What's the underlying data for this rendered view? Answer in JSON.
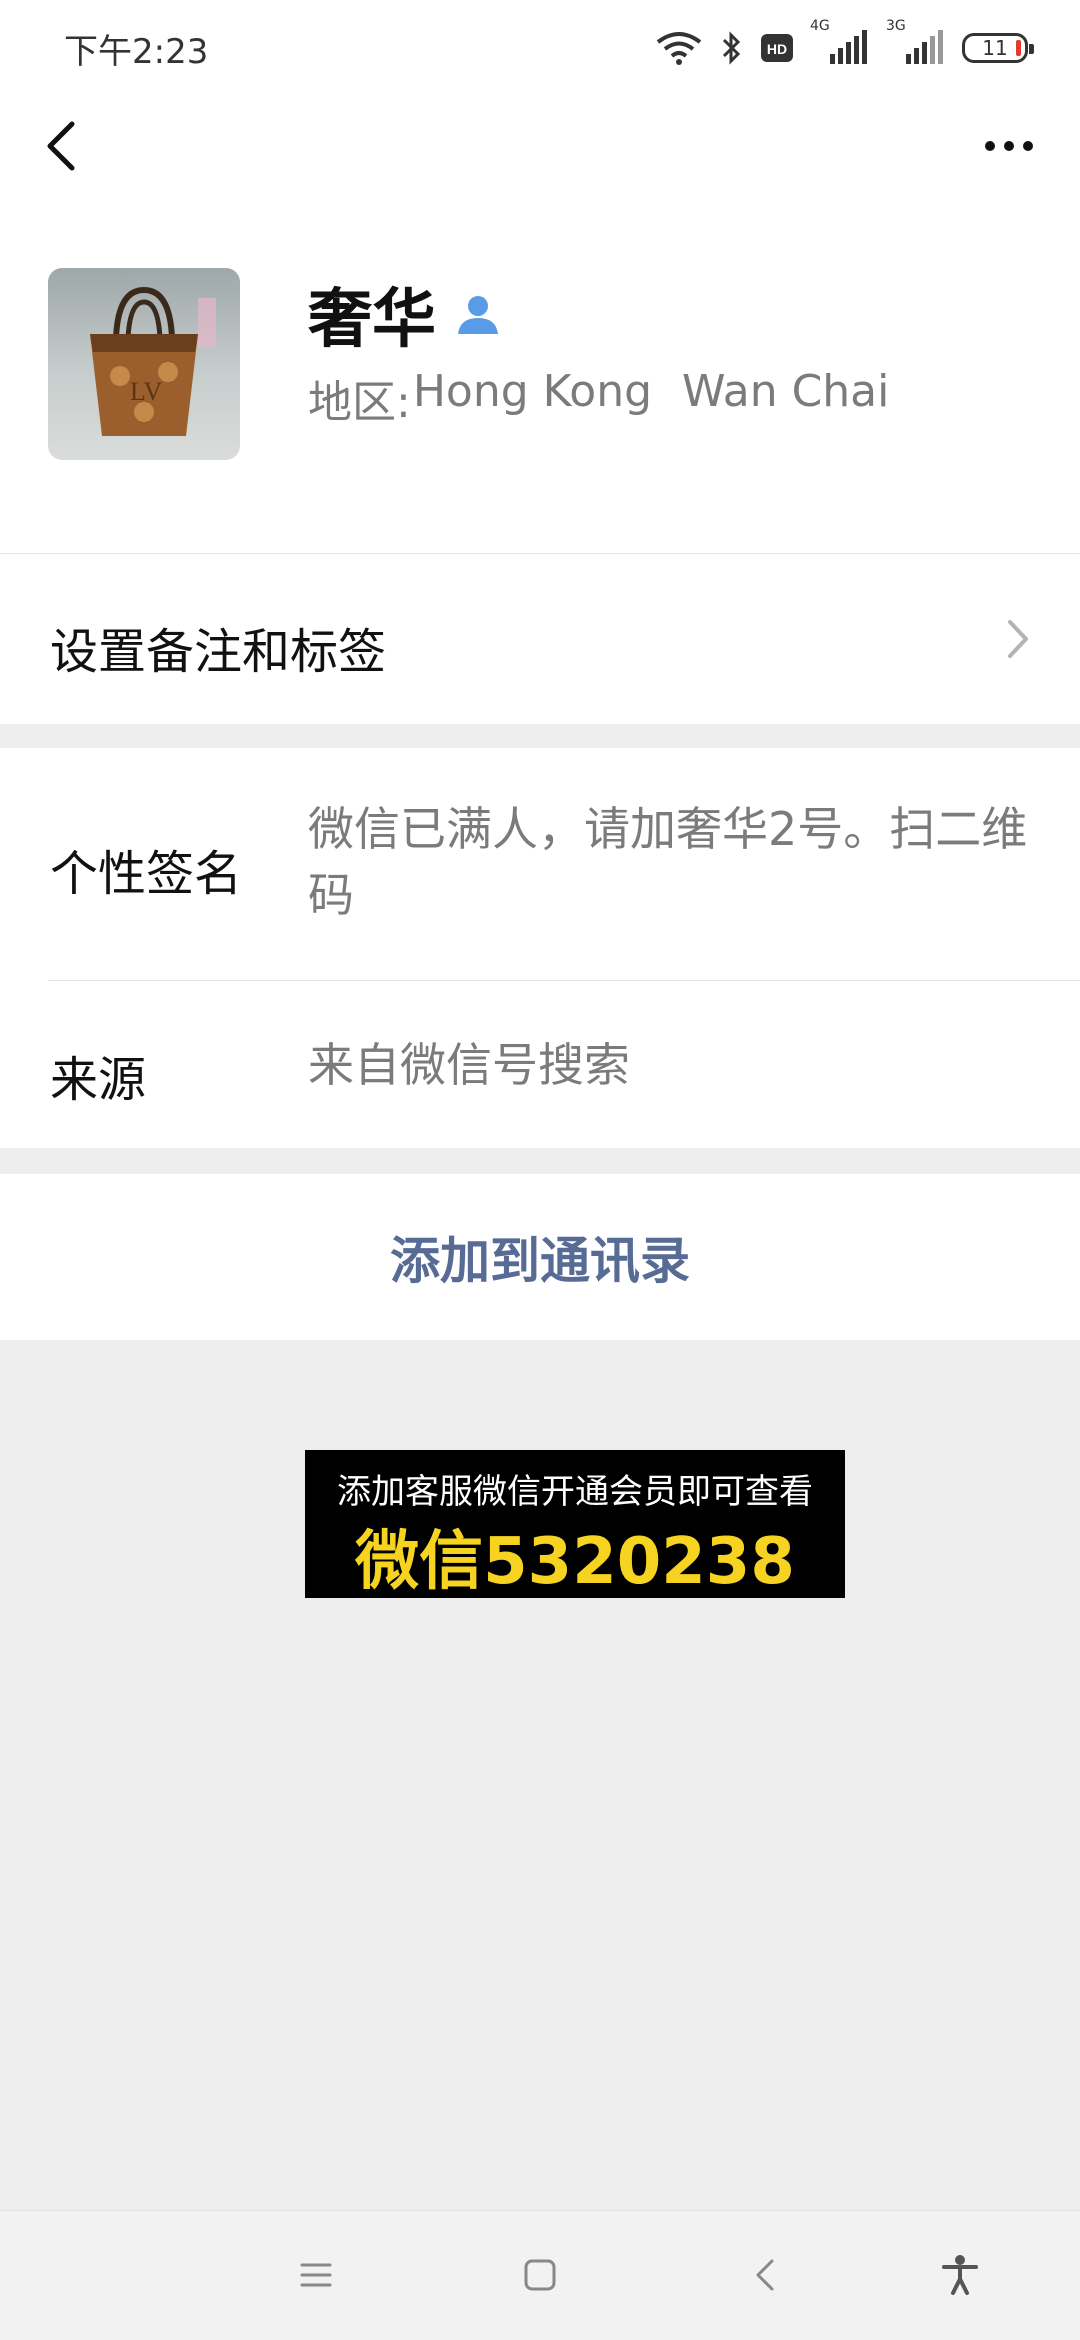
{
  "status_bar": {
    "time": "下午2:23",
    "network_1": "4G",
    "network_2": "3G",
    "battery": "11",
    "icons": [
      "wifi-icon",
      "bluetooth-icon",
      "hd-icon",
      "signal-icon",
      "signal-icon",
      "battery-icon"
    ]
  },
  "nav": {
    "back_icon": "chevron-left-icon",
    "more_icon": "more-dots-icon"
  },
  "profile": {
    "name": "奢华",
    "contact_icon": "contact-person-icon",
    "region_label": "地区:",
    "region_value_1": "Hong Kong",
    "region_value_2": "Wan Chai",
    "avatar_desc": "avatar"
  },
  "cells": {
    "remark_label": "设置备注和标签",
    "signature_label": "个性签名",
    "signature_value": "微信已满人，请加奢华2号。扫二维码",
    "source_label": "来源",
    "source_value": "来自微信号搜索",
    "add_button": "添加到通讯录"
  },
  "banner": {
    "line1": "添加客服微信开通会员即可查看",
    "line2": "微信5320238"
  },
  "colors": {
    "link_blue": "#576b95",
    "banner_yellow": "#f5d320",
    "background": "#ededed"
  }
}
